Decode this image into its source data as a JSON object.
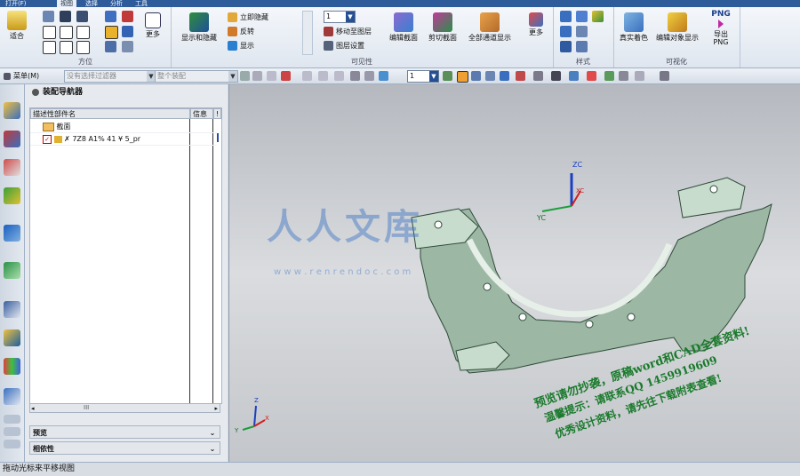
{
  "tabs": [
    {
      "label": "打开(F)",
      "active": false
    },
    {
      "label": "视图",
      "active": true
    },
    {
      "label": "选择",
      "active": false
    },
    {
      "label": "分析",
      "active": false
    },
    {
      "label": "工具",
      "active": false
    }
  ],
  "ribbon": {
    "groups": [
      {
        "label": "方位"
      },
      {
        "label": "可见性"
      },
      {
        "label": "样式"
      },
      {
        "label": "可视化"
      }
    ],
    "buttons": {
      "fit": "适合",
      "more1": "更多",
      "show_hide_dialog": "显示和隐藏",
      "show_immediately": "立即隐藏",
      "reverse": "反转",
      "show": "显示",
      "layer_value": "1",
      "move_to_layer": "移动至图层",
      "layer_settings": "图层设置",
      "edit_section": "编辑截面",
      "clip_section": "剪切截面",
      "all_channels": "全部通道显示",
      "more2": "更多",
      "true_shading": "真实着色",
      "edit_object_display": "编辑对象显示",
      "png_label": "PNG",
      "export_png": "导出 PNG"
    }
  },
  "toolbar2": {
    "menu_label": "菜单(M)",
    "select_filter_placeholder": "没有选择过滤器",
    "assembly_placeholder": "整个装配",
    "layer_value": "1"
  },
  "navigator": {
    "title": "装配导航器",
    "columns": [
      "描述性部件名",
      "信息",
      "!"
    ],
    "rows": [
      {
        "label": "截面",
        "type": "section"
      },
      {
        "label": "✗ 7Z8 A1% 41 ¥ 5_pr",
        "type": "part",
        "checked": true
      }
    ],
    "scroll_label": "III",
    "preview_label": "预览",
    "dependency_label": "相依性"
  },
  "viewport": {
    "axis_labels": {
      "zc": "ZC",
      "xc": "XC",
      "yc": "YC",
      "small_z": "Z",
      "small_y": "Y",
      "small_x": "X"
    },
    "watermark_logo": "人人文库",
    "watermark_url": "w w w . r e n r e n d o c . c o m",
    "watermark_lines": [
      "预览请勿抄袭，原稿word和CAD全套资料!",
      "温馨提示：请联系QQ 1459919609",
      "优秀设计资料，请先往下载附表查看!"
    ]
  },
  "status": {
    "text": "拖动光标来平移视图"
  },
  "colors": {
    "viewport_bg": "#c9ccd0",
    "part_fill": "#9cb8a4",
    "watermark_green": "#1a7a2c",
    "watermark_blue": "#3b73c4"
  }
}
